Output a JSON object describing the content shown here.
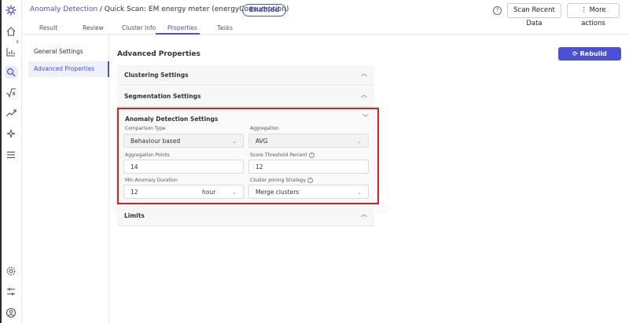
{
  "header": {
    "breadcrumb_link": "Anomaly Detection",
    "breadcrumb_rest": " / Quick Scan: EM energy meter (energyConsumption)",
    "status_badge": "Enabled",
    "help_glyph": "?",
    "scan_button": "Scan Recent Data",
    "more_button": "More actions"
  },
  "tabs": [
    {
      "label": "Result"
    },
    {
      "label": "Review"
    },
    {
      "label": "Cluster Info"
    },
    {
      "label": "Properties",
      "active": true
    },
    {
      "label": "Tasks"
    }
  ],
  "settings_nav": [
    {
      "label": "General Settings"
    },
    {
      "label": "Advanced Properties",
      "active": true
    }
  ],
  "main": {
    "title": "Advanced Properties",
    "rebuild_button": "Rebuild",
    "sections": {
      "clustering": "Clustering Settings",
      "segmentation": "Segmentation Settings",
      "anomaly": "Anomaly Detection Settings",
      "limits": "Limits"
    }
  },
  "anomaly_form": {
    "comparison_type": {
      "label": "Comparison Type",
      "value": "Behaviour based"
    },
    "aggregation": {
      "label": "Aggregation",
      "value": "AVG"
    },
    "aggregation_points": {
      "label": "Aggregation Points",
      "value": "14"
    },
    "score_threshold": {
      "label": "Score Threshold Percent",
      "value": "12"
    },
    "min_anomaly_duration": {
      "label": "Min Anomaly Duration",
      "value": "12",
      "unit": "hour"
    },
    "cluster_joining_strategy": {
      "label": "Cluster Joining Strategy",
      "value": "Merge clusters"
    },
    "info_glyph": "i"
  },
  "colors": {
    "accent": "#4b51d6",
    "highlight_border": "#e01b1b"
  },
  "icons": {
    "nav": [
      "home-icon",
      "chart-icon",
      "search-icon",
      "formula-icon",
      "trend-icon",
      "sparkle-icon",
      "menu-icon",
      "settings-icon",
      "sliders-icon",
      "user-icon"
    ]
  }
}
